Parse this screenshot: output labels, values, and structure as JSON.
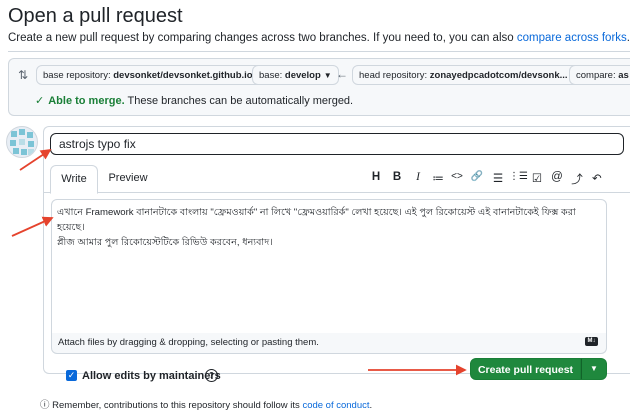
{
  "page": {
    "title": "Open a pull request",
    "subtitle": "Create a new pull request by comparing changes across two branches. If you need to, you can also",
    "compare_forks_link": "compare across forks",
    "subtitle_end": "."
  },
  "compare": {
    "base_repo_label": "base repository:",
    "base_repo_value": "devsonket/devsonket.github.io",
    "base_label": "base:",
    "base_value": "develop",
    "head_repo_label": "head repository:",
    "head_repo_value": "zonayedpcadotcom/devsonk...",
    "compare_label": "compare:",
    "compare_value": "as",
    "merge_check": "✓",
    "merge_ok": "Able to merge.",
    "merge_text": "These branches can be automatically merged."
  },
  "editor": {
    "title_value": "astrojs typo fix",
    "tabs": [
      "Write",
      "Preview"
    ],
    "toolbar": [
      "H",
      "B",
      "I",
      "≔",
      "<>",
      "🔗",
      "☰",
      "⋮☰",
      "☑",
      "@",
      "⤴",
      "↶"
    ],
    "body": "এখানে Framework বানানটাকে বাংলায় \"ফ্রেমওয়ার্ক\" না লিখে \"ফ্রেমওয়ারির্ক\" লেখা হয়েছে। এই পুল রিকোয়েস্ট এই বানানটাকেই ফিক্স করা হয়েছে।\nপ্লীজ আমার পুল রিকোয়েস্টটিকে রিভিউ করবেন, ধন্যবাদ।",
    "attach_text": "Attach files by dragging & dropping, selecting or pasting them.",
    "md_badge": "M↓"
  },
  "actions": {
    "allow_edits_label": "Allow edits by maintainers",
    "create_button": "Create pull request",
    "note": "Remember, contributions to this repository should follow its",
    "note_link": "code of conduct",
    "note_end": "."
  },
  "colors": {
    "accent": "#0969da",
    "primary_button": "#1f883d",
    "merge_green": "#1a7f37",
    "annotation_red": "#e5432d"
  }
}
